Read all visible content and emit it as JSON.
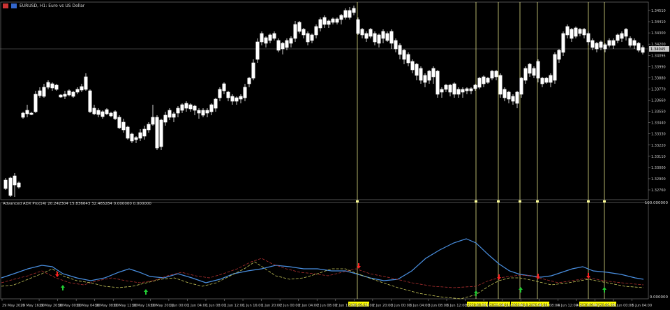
{
  "window": {
    "title": "EURUSD, H1:  Euro vs US Dollar"
  },
  "indicator": {
    "label": "Advanced ADX Pro(14) 20.242304  15.836643  32.465284  0.000000  0.000000",
    "scale_top": "100.000000",
    "scale_bottom": "0.000000"
  },
  "price_axis": {
    "labels": [
      "1.34510",
      "1.34410",
      "1.34300",
      "1.34200",
      "1.34095",
      "1.33990",
      "1.33880",
      "1.33770",
      "1.33660",
      "1.33550",
      "1.33440",
      "1.33330",
      "1.33220",
      "1.33110",
      "1.33000",
      "1.32900",
      "1.32760"
    ],
    "current_price": "1.34045"
  },
  "time_axis": {
    "labels": [
      "29 May 2020",
      "29 May 16:00",
      "29 May 20:00",
      "30 May 00:00",
      "30 May 04:00",
      "30 May 08:00",
      "30 May 12:00",
      "30 May 16:00",
      "30 May 20:00",
      "1 Jun 00:00",
      "1 Jun 04:00",
      "1 Jun 08:00",
      "1 Jun 12:00",
      "1 Jun 16:00",
      "1 Jun 20:00",
      "2 Jun 00:00",
      "2 Jun 04:00",
      "2 Jun 08:00",
      "2 Jun 12:00",
      "2 Jun 16:00",
      "2 Jun 20:00",
      "3 Jun 00:00",
      "3 Jun 04:00",
      "3 Jun 08:00",
      "3 Jun 12:00",
      "3 Jun 16:00",
      "3 Jun 20:00",
      "4 Jun 00:00",
      "4 Jun 04:00",
      "4 Jun 08:00",
      "4 Jun 12:00",
      "4 Jun 16:00",
      "4 Jun 20:00",
      "5 Jun 00:00",
      "5 Jun 04:00"
    ],
    "highlights": [
      "2020.06.03 02:00",
      "2020.06.04 05:00",
      "2020.06.04 07:00",
      "2020.06.04 10:00",
      "2020.06.04 12:00",
      "2020.06.05 03:00",
      "2020.06.05 05:00"
    ]
  },
  "colors": {
    "background": "#000000",
    "candle_bull": "#ffffff",
    "candle_bear": "#ffffff",
    "adx_line": "#4a90e2",
    "plus_di": "#c8c85a",
    "minus_di": "#b03030",
    "signal_line": "#ffff99",
    "highlight_bg": "#ffff00",
    "arrow_up": "#22cc33",
    "arrow_down": "#ff2222"
  },
  "icons": [
    "chart-icon",
    "arrow-up-icon",
    "arrow-down-icon"
  ]
}
